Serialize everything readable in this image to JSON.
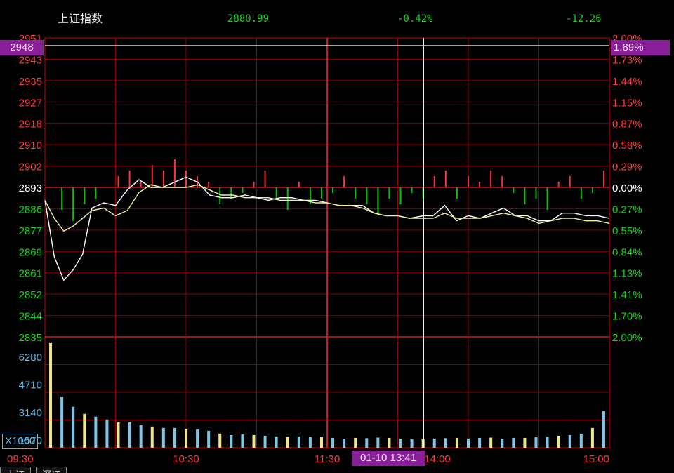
{
  "header": {
    "name": "上证指数",
    "price": "2880.99",
    "pct": "-0.42%",
    "change": "-12.26"
  },
  "crosshair": {
    "price_label": "2948",
    "pct_label": "1.89%",
    "time_label": "01-10 13:41"
  },
  "volume_unit": "X1000",
  "bottom_tabs": [
    "上证",
    "深证"
  ],
  "colors": {
    "grid": "#8b0000",
    "up": "#ff3333",
    "down": "#00c800",
    "price_line": "#ffffff",
    "avg_line": "#f5f0a0",
    "volume": "#7fc6e8",
    "volume_alt": "#f0e68c",
    "tag_bg": "#8a1f9a",
    "crosshair": "#ffffff"
  },
  "chart_data": {
    "type": "line",
    "title": "上证指数",
    "reference_close": 2893,
    "price_axis_ticks": [
      "2951",
      "2943",
      "2935",
      "2927",
      "2918",
      "2910",
      "2902",
      "2893",
      "2886",
      "2877",
      "2869",
      "2861",
      "2852",
      "2844",
      "2835"
    ],
    "pct_axis_ticks": [
      "2.00%",
      "1.73%",
      "1.44%",
      "1.15%",
      "0.87%",
      "0.58%",
      "0.29%",
      "0.00%",
      "0.27%",
      "0.55%",
      "0.84%",
      "1.13%",
      "1.41%",
      "1.70%",
      "2.00%"
    ],
    "ylim": [
      2835,
      2951
    ],
    "volume_axis_ticks": [
      "6280",
      "4710",
      "3140",
      "1570"
    ],
    "volume_ylim": [
      0,
      7850
    ],
    "time_ticks": [
      "09:30",
      "10:30",
      "11:30",
      "14:00",
      "15:00"
    ],
    "series": [
      {
        "x": [
          "09:30",
          "09:34",
          "09:38",
          "09:42",
          "09:46",
          "09:50",
          "09:55",
          "10:00",
          "10:05",
          "10:10",
          "10:15",
          "10:20",
          "10:25",
          "10:30",
          "10:35",
          "10:40",
          "10:45",
          "10:50",
          "10:55",
          "11:00",
          "11:05",
          "11:10",
          "11:15",
          "11:20",
          "11:25",
          "11:30",
          "13:05",
          "13:10",
          "13:15",
          "13:20",
          "13:25",
          "13:30",
          "13:35",
          "13:41",
          "13:45",
          "13:50",
          "13:55",
          "14:00",
          "14:05",
          "14:10",
          "14:15",
          "14:20",
          "14:25",
          "14:30",
          "14:35",
          "14:40",
          "14:45",
          "14:50",
          "14:55",
          "15:00"
        ],
        "values": [
          2888,
          2866,
          2857,
          2861,
          2867,
          2885,
          2887,
          2886,
          2892,
          2896,
          2893,
          2893,
          2895,
          2897,
          2895,
          2890,
          2889,
          2889,
          2890,
          2889,
          2888,
          2889,
          2889,
          2888,
          2888,
          2887,
          2886,
          2886,
          2886,
          2883,
          2882,
          2882,
          2881,
          2882,
          2882,
          2886,
          2880,
          2882,
          2881,
          2883,
          2885,
          2882,
          2882,
          2880,
          2880,
          2883,
          2883,
          2882,
          2882,
          2881
        ]
      },
      {
        "x": [
          "09:30",
          "09:34",
          "09:38",
          "09:42",
          "09:46",
          "09:50",
          "09:55",
          "10:00",
          "10:05",
          "10:10",
          "10:15",
          "10:20",
          "10:25",
          "10:30",
          "10:35",
          "10:40",
          "10:45",
          "10:50",
          "10:55",
          "11:00",
          "11:05",
          "11:10",
          "11:15",
          "11:20",
          "11:25",
          "11:30",
          "13:05",
          "13:10",
          "13:15",
          "13:20",
          "13:25",
          "13:30",
          "13:35",
          "13:41",
          "13:45",
          "13:50",
          "13:55",
          "14:00",
          "14:05",
          "14:10",
          "14:15",
          "14:20",
          "14:25",
          "14:30",
          "14:35",
          "14:40",
          "14:45",
          "14:50",
          "14:55",
          "15:00"
        ],
        "values": [
          2888,
          2881,
          2876,
          2878,
          2881,
          2884,
          2885,
          2882,
          2884,
          2891,
          2894,
          2893,
          2893,
          2893,
          2894,
          2892,
          2890,
          2890,
          2889,
          2889,
          2889,
          2888,
          2888,
          2888,
          2887,
          2887,
          2886,
          2886,
          2885,
          2883,
          2882,
          2882,
          2881,
          2881,
          2881,
          2883,
          2881,
          2881,
          2881,
          2882,
          2883,
          2882,
          2881,
          2879,
          2880,
          2881,
          2881,
          2880,
          2880,
          2879
        ]
      }
    ],
    "deviation_bars": [
      0,
      -4,
      -6,
      -3,
      -2,
      0,
      2,
      3,
      1,
      4,
      3,
      5,
      3,
      2,
      1,
      -3,
      -2,
      -1,
      1,
      3,
      -2,
      -4,
      1,
      -3,
      -2,
      -1,
      2,
      -2,
      -3,
      -5,
      -2,
      -3,
      -1,
      -2,
      2,
      3,
      -2,
      2,
      1,
      3,
      2,
      -1,
      -3,
      -2,
      -4,
      1,
      2,
      -2,
      -1,
      3
    ],
    "volume": [
      7400,
      3600,
      2900,
      2400,
      2200,
      2000,
      1800,
      1800,
      1600,
      1500,
      1400,
      1400,
      1300,
      1300,
      1200,
      1000,
      900,
      950,
      900,
      850,
      800,
      780,
      800,
      750,
      760,
      700,
      650,
      700,
      680,
      720,
      700,
      650,
      600,
      600,
      650,
      680,
      700,
      650,
      700,
      720,
      650,
      700,
      700,
      750,
      800,
      850,
      900,
      1000,
      1400,
      2600
    ]
  }
}
